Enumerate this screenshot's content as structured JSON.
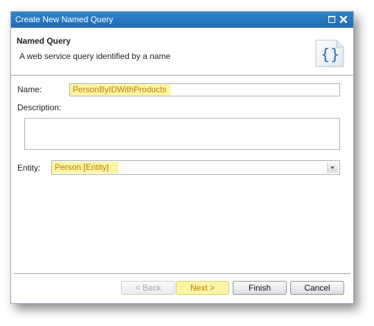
{
  "window": {
    "title": "Create New Named Query"
  },
  "header": {
    "title": "Named Query",
    "description": "A web service query identified by a name",
    "icon": "curly-braces-icon"
  },
  "form": {
    "name_label": "Name:",
    "name_value": "PersonByIDWithProducts",
    "description_label": "Description:",
    "description_value": "",
    "entity_label": "Entity:",
    "entity_value": "Person [Entity]"
  },
  "buttons": {
    "back": "< Back",
    "next": "Next >",
    "finish": "Finish",
    "cancel": "Cancel"
  },
  "colors": {
    "titlebar": "#1f6cb3",
    "highlight": "#fdf5a6",
    "highlight_text": "#c47a00"
  }
}
